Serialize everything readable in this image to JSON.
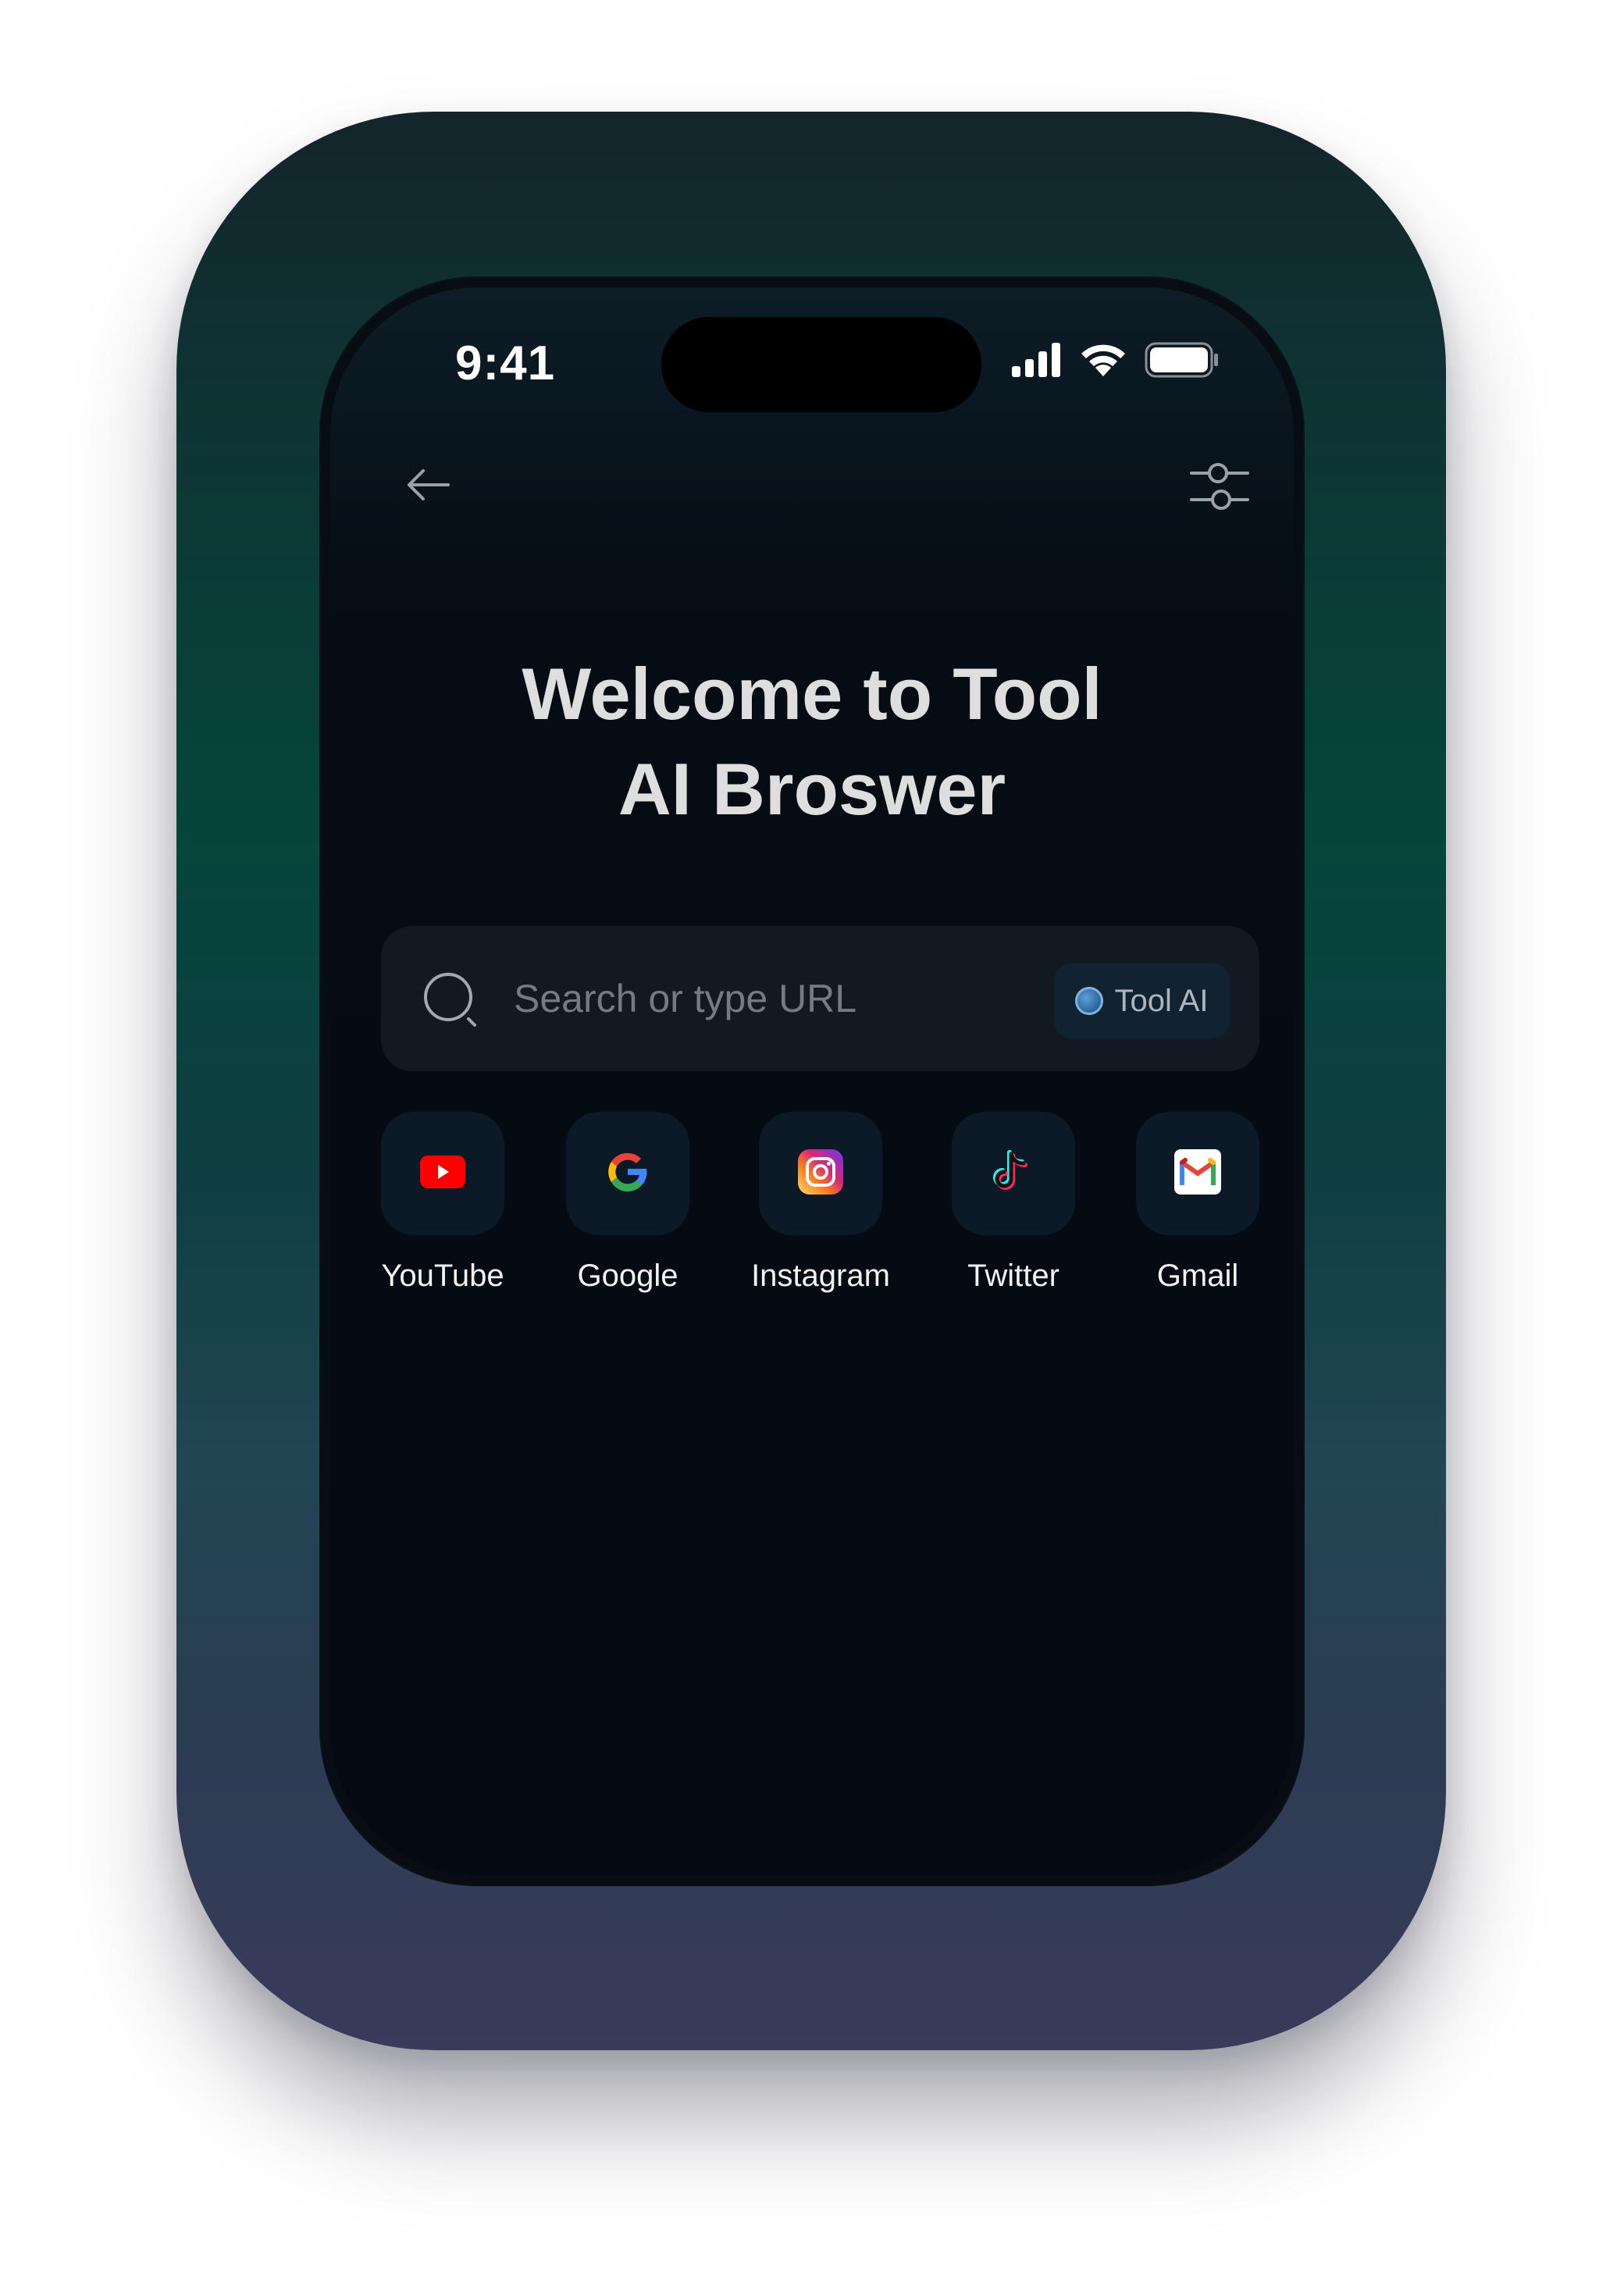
{
  "status_bar": {
    "time": "9:41",
    "icons": [
      "cellular-signal-icon",
      "wifi-icon",
      "battery-icon"
    ]
  },
  "nav": {
    "back_icon": "arrow-left-icon",
    "settings_icon": "sliders-icon"
  },
  "title": {
    "line1": "Welcome to Tool",
    "line2": "AI Broswer"
  },
  "search": {
    "placeholder": "Search or type URL",
    "value": "",
    "icon": "search-icon",
    "ai_button_label": "Tool AI"
  },
  "shortcuts": [
    {
      "label": "YouTube",
      "icon": "youtube-icon"
    },
    {
      "label": "Google",
      "icon": "google-icon"
    },
    {
      "label": "Instagram",
      "icon": "instagram-icon"
    },
    {
      "label": "Twitter",
      "icon": "tiktok-icon"
    },
    {
      "label": "Gmail",
      "icon": "gmail-icon"
    }
  ],
  "colors": {
    "screen_background": "#040a10",
    "search_background": "#111a22",
    "tile_background": "#0b1a26",
    "title_text": "#dedede",
    "placeholder_text": "#747b82"
  }
}
